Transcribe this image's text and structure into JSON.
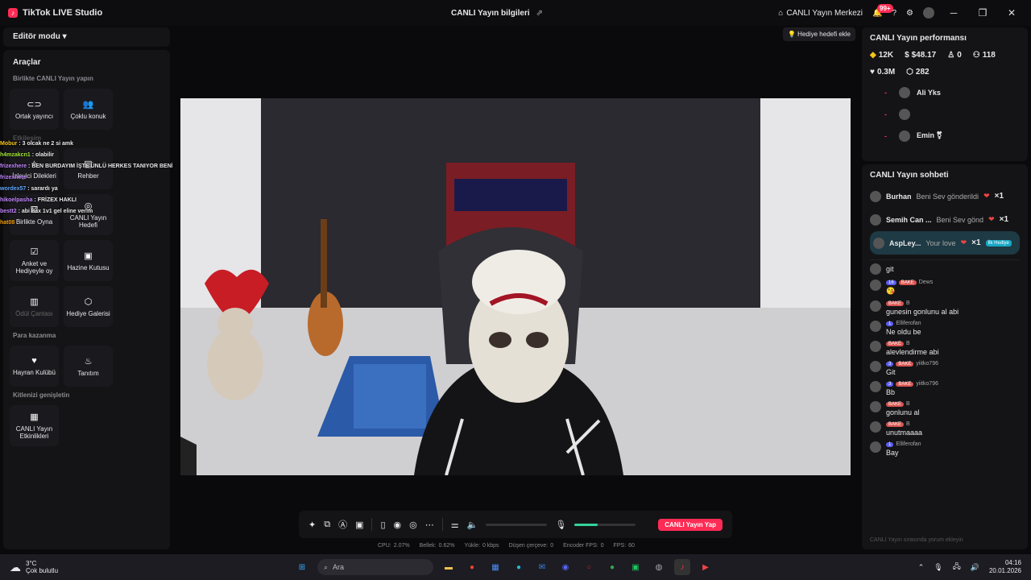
{
  "titlebar": {
    "app_name": "TikTok LIVE Studio",
    "center_title": "CANLI Yayın bilgileri",
    "live_center": "CANLI Yayın Merkezi",
    "notif_count": "99+"
  },
  "left": {
    "editor_mode": "Editör modu",
    "tools_title": "Araçlar",
    "sections": {
      "together": "Birlikte CANLI Yayın yapın",
      "interaction": "Etkileşim",
      "monetize": "Para kazanma",
      "expand": "Kitlenizi genişletin"
    },
    "together_tiles": [
      {
        "label": "Ortak yayıncı",
        "icon": "link-icon"
      },
      {
        "label": "Çoklu konuk",
        "icon": "users-icon"
      }
    ],
    "interaction_tiles": [
      {
        "label": "İzleyici Dilekleri",
        "icon": "star-icon"
      },
      {
        "label": "Rehber",
        "icon": "book-icon"
      },
      {
        "label": "Birlikte Oyna",
        "icon": "gamepad-icon"
      },
      {
        "label": "CANLI Yayın Hedefi",
        "icon": "target-icon"
      },
      {
        "label": "Anket ve Hediyeyle oy",
        "icon": "poll-icon"
      },
      {
        "label": "Hazine Kutusu",
        "icon": "chest-icon"
      },
      {
        "label": "Ödül Çantası",
        "icon": "bag-icon"
      },
      {
        "label": "Hediye Galerisi",
        "icon": "gift-icon"
      }
    ],
    "monetize_tiles": [
      {
        "label": "Hayran Kulübü",
        "icon": "heart-icon"
      },
      {
        "label": "Tanıtım",
        "icon": "flame-icon"
      }
    ],
    "expand_tiles": [
      {
        "label": "CANLI Yayın Etkinlikleri",
        "icon": "calendar-icon"
      }
    ],
    "chat_overlay": [
      {
        "user": "Mobur",
        "text": "3 olcak ne 2 si amk",
        "color": "#f5c518"
      },
      {
        "user": "h4mzakcn1",
        "text": "olabilir",
        "color": "#a3e635"
      },
      {
        "user": "frizexhere",
        "text": "BEN BURDAYIM İŞTE ÜNLÜ HERKES TANIYOR BENİ @BakeMask",
        "color": "#c084fc"
      },
      {
        "user": "frizexhere",
        "text": "",
        "color": "#c084fc"
      },
      {
        "user": "wordex57",
        "text": "sarardı ya",
        "color": "#60a5fa"
      },
      {
        "user": "hikoelpasha",
        "text": "FRİZEX HAKLI",
        "color": "#c084fc"
      },
      {
        "user": "bestt2",
        "text": "abi hax 1v1 gel eline verim",
        "color": "#c084fc"
      },
      {
        "user": "hat08",
        "text": "",
        "color": "#f59e0b"
      }
    ]
  },
  "center": {
    "gift_goal": "Hediye hedefi ekle",
    "go_live": "CANLI Yayın Yap",
    "stats": [
      {
        "label": "CPU:",
        "value": "2.07%"
      },
      {
        "label": "Bellek:",
        "value": "0.62%"
      },
      {
        "label": "Yükle:",
        "value": "0 kbps"
      },
      {
        "label": "Düşen çerçeve:",
        "value": "0"
      },
      {
        "label": "Encoder FPS:",
        "value": "0"
      },
      {
        "label": "FPS:",
        "value": "60"
      }
    ],
    "mic_level": 0.38
  },
  "right": {
    "perf_title": "CANLI Yayın performansı",
    "metrics": [
      {
        "icon": "diamond-icon",
        "value": "12K"
      },
      {
        "icon": "dollar-icon",
        "value": "$48.17"
      },
      {
        "icon": "user-icon",
        "value": "0"
      },
      {
        "icon": "followers-icon",
        "value": "118"
      }
    ],
    "metrics2": [
      {
        "icon": "heart-icon",
        "value": "0.3M"
      },
      {
        "icon": "gift-icon",
        "value": "282"
      }
    ],
    "viewers": [
      {
        "name": "Ali Yks"
      },
      {
        "name": ""
      },
      {
        "name": "Emin ⚧"
      }
    ],
    "chat_title": "CANLI Yayın sohbeti",
    "gifts": [
      {
        "user": "Burhan",
        "text": "Beni Sev gönderildi",
        "count": "×1"
      },
      {
        "user": "Semih Can ...",
        "text": "Beni Sev gönd",
        "count": "×1"
      },
      {
        "user": "AspLey...",
        "text": "Your love",
        "count": "×1",
        "badge": "İlk Hediye"
      }
    ],
    "messages": [
      {
        "user": "",
        "lvl": "",
        "bake": "",
        "text": "git"
      },
      {
        "user": "Dews",
        "lvl": "16",
        "bake": "BAKE",
        "text": "😘"
      },
      {
        "user": "B",
        "lvl": "",
        "bake": "BAKE",
        "text": "gunesin gonlunu al abi"
      },
      {
        "user": "Elliferofan",
        "lvl": "1",
        "bake": "",
        "text": "Ne oldu be"
      },
      {
        "user": "B",
        "lvl": "",
        "bake": "BAKE",
        "text": "alevlendirme abi"
      },
      {
        "user": "yiitko796",
        "lvl": "3",
        "bake": "BAKE",
        "text": "Git"
      },
      {
        "user": "yiitko796",
        "lvl": "3",
        "bake": "BAKE",
        "text": "Bb"
      },
      {
        "user": "B",
        "lvl": "",
        "bake": "BAKE",
        "text": "gonlunu al"
      },
      {
        "user": "B",
        "lvl": "",
        "bake": "BAKE",
        "text": "unutmaaaa"
      },
      {
        "user": "Elliferofan",
        "lvl": "1",
        "bake": "",
        "text": "Bay"
      }
    ],
    "chat_placeholder": "CANLI Yayın sırasında yorum ekleyin"
  },
  "taskbar": {
    "temp": "3°C",
    "weather": "Çok bulutlu",
    "search": "Ara",
    "time": "04:16",
    "date": "20.01.2026"
  }
}
